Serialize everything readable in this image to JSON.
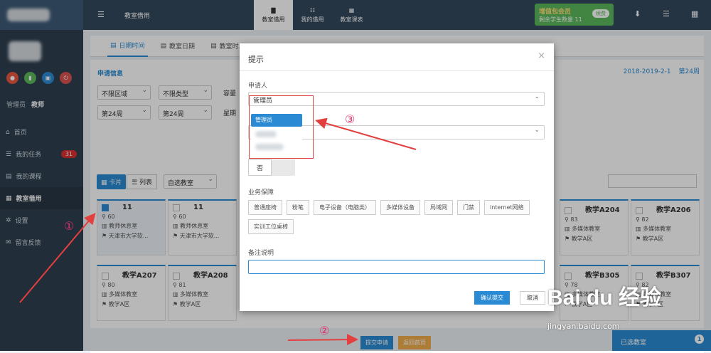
{
  "topbar": {
    "title": "教室借用",
    "tabs": [
      {
        "label": "教室借用"
      },
      {
        "label": "我的借用"
      },
      {
        "label": "教室课表"
      }
    ],
    "vip_title": "增值包会员",
    "vip_sub": "剩余学生数量 11",
    "vip_btn": "续费"
  },
  "sidebar": {
    "role_a": "管理员",
    "role_b": "教师",
    "items": [
      {
        "label": "首页"
      },
      {
        "label": "我的任务",
        "badge": "31"
      },
      {
        "label": "我的课程"
      },
      {
        "label": "教室借用"
      },
      {
        "label": "设置"
      },
      {
        "label": "留言反馈"
      }
    ]
  },
  "tabs": [
    {
      "label": "日期时间"
    },
    {
      "label": "教室日期"
    },
    {
      "label": "教室时..."
    }
  ],
  "apply": {
    "title": "申请信息",
    "semester": "2018-2019-2-1",
    "week": "第24周",
    "f1": "不限区域",
    "f2": "不限类型",
    "f3": "容量",
    "w1": "第24周",
    "w2": "第24周",
    "w3": "星期"
  },
  "list": {
    "card_btn": "卡片",
    "list_btn": "列表",
    "custom": "自选教室"
  },
  "cards": [
    {
      "name": "11",
      "cap": "60",
      "type": "教师休息室",
      "loc": "天津市大学软..."
    },
    {
      "name": "11",
      "cap": "60",
      "type": "教师休息室",
      "loc": "天津市大学软..."
    },
    {
      "name": "教学A204",
      "cap": "83",
      "type": "多媒体教室",
      "loc": "教学A区"
    },
    {
      "name": "教学A206",
      "cap": "82",
      "type": "多媒体教室",
      "loc": "教学A区"
    },
    {
      "name": "教学A207",
      "cap": "80",
      "type": "多媒体教室",
      "loc": "教学A区"
    },
    {
      "name": "教学A208",
      "cap": "81",
      "type": "多媒体教室",
      "loc": "教学A区"
    },
    {
      "name": "教学B305",
      "cap": "78",
      "type": "多媒体教室",
      "loc": "教学A区"
    },
    {
      "name": "教学B307",
      "cap": "82",
      "type": "多媒体教室",
      "loc": "教学A区"
    }
  ],
  "footer": {
    "submit": "提交申请",
    "back": "返回首页",
    "selected": "已选教室",
    "count": "1"
  },
  "modal": {
    "title": "提示",
    "close": "×",
    "applicant_label": "申请人",
    "applicant_value": "管理员",
    "option_selected": "管理员",
    "toggle_no": "否",
    "service_label": "业务保障",
    "services": [
      "普通座椅",
      "粉笔",
      "电子设备（电脑类）",
      "多媒体设备",
      "局域网",
      "门禁",
      "internet网络",
      "实训工位桌椅"
    ],
    "remark_label": "备注说明",
    "ok": "确认提交",
    "cancel": "取消"
  },
  "annotations": {
    "a1": "①",
    "a2": "②",
    "a3": "③"
  },
  "watermark": {
    "brand": "Bai du 经验",
    "url": "jingyan.baidu.com"
  }
}
